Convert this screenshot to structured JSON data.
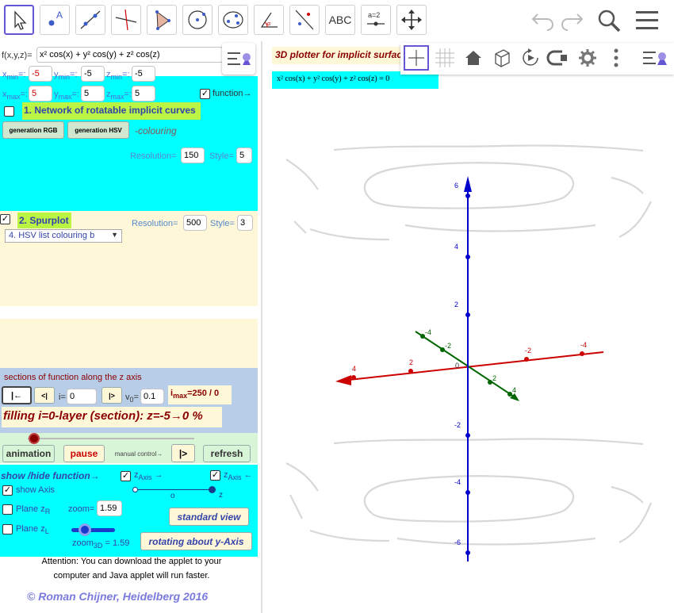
{
  "toolbar": {
    "tools": [
      "move-tool",
      "point-tool",
      "line-tool",
      "perpendicular-tool",
      "polygon-tool",
      "circle-tool",
      "conic-tool",
      "angle-tool",
      "reflect-tool",
      "text-tool",
      "slider-tool",
      "move-view-tool"
    ],
    "text_label": "ABC",
    "slider_label": "a=2"
  },
  "left": {
    "function_label": "f(x,y,z)=",
    "function_value": "x² cos(x) + y² cos(y) + z² cos(z)",
    "xmin_label": "x",
    "xmin_sub": "min",
    "xmin": "-5",
    "ymin_label": "y",
    "ymin_sub": "min",
    "ymin": "-5",
    "zmin_label": "z",
    "zmin_sub": "min",
    "zmin": "-5",
    "xmax_label": "x",
    "xmax_sub": "max",
    "xmax": "5",
    "ymax_label": "y",
    "ymax_sub": "max",
    "ymax": "5",
    "zmax_label": "z",
    "zmax_sub": "max",
    "zmax": "5",
    "eq": "=:",
    "function_check": "function→",
    "section1_title": "1. Network of  rotatable implicit curves",
    "gen_rgb": "generation RGB",
    "gen_hsv": "generation HSV",
    "colouring": "-colouring",
    "resolution_label": "Resolution=",
    "resolution1": "150",
    "style_label": "Style=",
    "style1": "5",
    "section2_title": "2. Spurplot",
    "resolution2": "500",
    "style2": "3",
    "dropdown": "4. HSV  list colouring b",
    "sections_title": "sections of function along the z axis",
    "i_label": "i=",
    "i_value": "0",
    "v_label": "v",
    "v_sub": "0",
    "v_eq": "=",
    "v_value": "0.1",
    "imax_label": "i",
    "imax_sub": "max",
    "imax_value": "=250  / 0",
    "filling": "filling  i=0-layer (section): z=-5→0 %",
    "animation": "animation",
    "pause": "pause",
    "manual": "manual control→",
    "refresh": "refresh",
    "show_hide": "show /hide function→",
    "zaxis1": "z",
    "zaxis1_sub": "Axis",
    "zaxis1_arrow": "→",
    "zaxis2": "z",
    "zaxis2_sub": "Axis",
    "zaxis2_arrow": "←",
    "show_axis": "show Axis",
    "plane_zr": "Plane z",
    "plane_zr_sub": "R",
    "plane_zl": "Plane z",
    "plane_zl_sub": "L",
    "zoom_label": "zoom=",
    "zoom_value": "1.59",
    "standard_view": "standard view",
    "zoom3d_label": "zoom",
    "zoom3d_sub": "3D",
    "zoom3d_value": " = 1.59",
    "rotating": "rotating about y-Axis",
    "slider_o": "o",
    "slider_z": "z",
    "attention": "Attention: You can download the applet  to your computer  and Java applet will run faster.",
    "copyright": "© Roman Chijner,  Heidelberg  2016"
  },
  "graphics": {
    "title": "3D plotter for implicit surfac",
    "equation": "x² cos(x) + y² cos(y) + z² cos(z) = 0",
    "z_ticks": [
      "6",
      "4",
      "2",
      "-2",
      "-4",
      "-6"
    ],
    "x_ticks": [
      "4",
      "2",
      "-2",
      "-4"
    ],
    "y_ticks": [
      "-4",
      "-2",
      "2",
      "4"
    ],
    "origin": "0",
    "colors": {
      "z_axis": "#0000cc",
      "x_axis": "#cc0000",
      "y_axis": "#006600",
      "accent": "#6557d2"
    }
  }
}
